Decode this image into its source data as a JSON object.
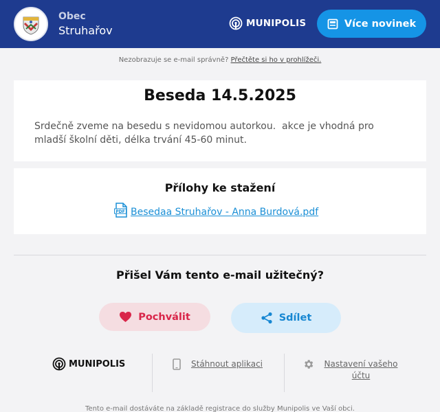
{
  "header": {
    "org_label": "Obec",
    "org_name": "Struhařov",
    "brand": "MUNIPOLIS",
    "more_news_label": "Více novinek"
  },
  "notice": {
    "text": "Nezobrazuje se e-mail správně?",
    "link": "Přečtěte si ho v prohlížeči."
  },
  "article": {
    "title": "Beseda 14.5.2025",
    "body": "Srdečně zveme na besedu s nevidomou autorkou.  akce je vhodná pro mladší školní děti, délka trvání 45-60 minut."
  },
  "attachments": {
    "title": "Přílohy ke stažení",
    "files": [
      {
        "name": "Besedaa Struhařov - Anna Burdová.pdf",
        "icon": "pdf-file-icon"
      }
    ]
  },
  "feedback": {
    "question": "Přišel Vám tento e-mail užitečný?",
    "praise_label": "Pochválit",
    "share_label": "Sdílet"
  },
  "footer": {
    "brand": "MUNIPOLIS",
    "download_app": "Stáhnout aplikaci",
    "settings": "Nastavení vašeho účtu",
    "note": "Tento e-mail dostáváte na základě registrace do služby Munipolis ve Vaší obci."
  },
  "colors": {
    "header_bg": "#1e3b8f",
    "primary_button": "#1594e6",
    "praise": "#d9264a",
    "share": "#1787d2",
    "link": "#1a8fd6"
  }
}
